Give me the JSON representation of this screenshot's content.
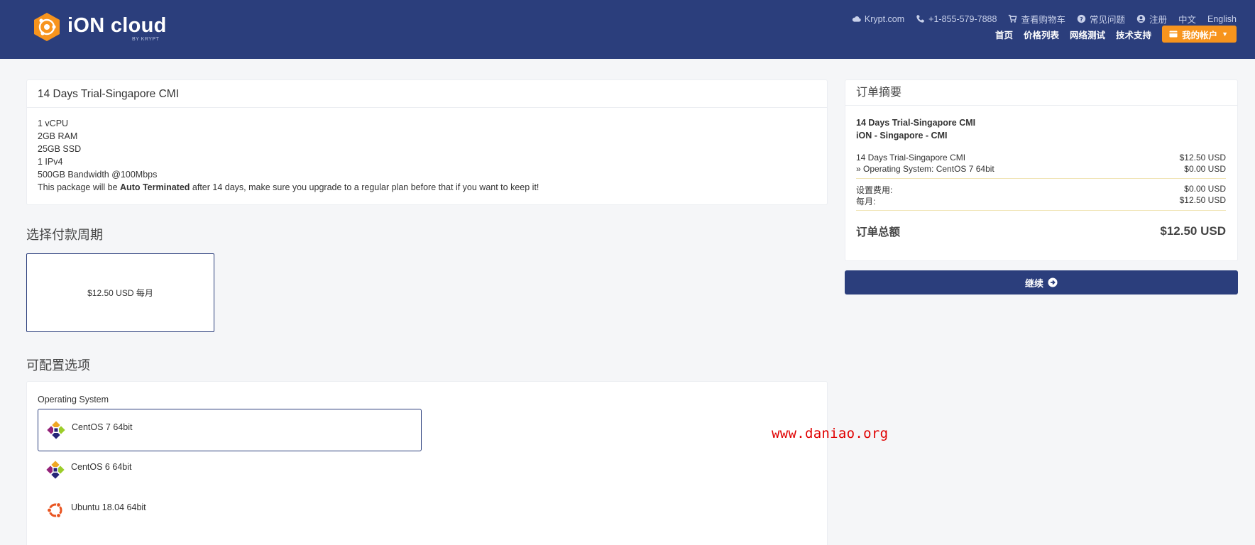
{
  "brand": {
    "name": "iON cloud",
    "sub": "BY KRYPT"
  },
  "topbar": {
    "krypt": "Krypt.com",
    "phone": "+1-855-579-7888",
    "cart": "查看购物车",
    "faq": "常见问题",
    "register": "注册",
    "lang_cn": "中文",
    "lang_en": "English"
  },
  "nav": {
    "home": "首页",
    "pricing": "价格列表",
    "nettest": "网络测试",
    "support": "技术支持",
    "account": "我的帐户"
  },
  "product": {
    "title": "14 Days Trial-Singapore CMI",
    "specs": [
      "1 vCPU",
      "2GB RAM",
      "25GB SSD",
      "1 IPv4",
      "500GB Bandwidth @100Mbps"
    ],
    "note_pre": "This package will be ",
    "note_bold": "Auto Terminated",
    "note_post": " after 14 days, make sure you upgrade to a regular plan before that if you want to keep it!"
  },
  "billing": {
    "heading": "选择付款周期",
    "option": "$12.50 USD 每月"
  },
  "config": {
    "heading": "可配置选项",
    "label": "Operating System",
    "options": [
      {
        "name": "CentOS 7 64bit",
        "icon": "centos-icon",
        "selected": true
      },
      {
        "name": "CentOS 6 64bit",
        "icon": "centos-icon",
        "selected": false
      },
      {
        "name": "Ubuntu 18.04 64bit",
        "icon": "ubuntu-icon",
        "selected": false
      }
    ]
  },
  "summary": {
    "title": "订单摘要",
    "product": "14 Days Trial-Singapore CMI",
    "group": "iON - Singapore - CMI",
    "lines": [
      {
        "label": "14 Days Trial-Singapore CMI",
        "value": "$12.50 USD"
      },
      {
        "label": "» Operating System: CentOS 7 64bit",
        "value": "$0.00 USD"
      }
    ],
    "setup_label": "设置费用:",
    "setup_value": "$0.00 USD",
    "monthly_label": "每月:",
    "monthly_value": "$12.50 USD",
    "total_label": "订单总额",
    "total_value": "$12.50 USD"
  },
  "continue_label": "继续",
  "watermark": "www.daniao.org",
  "colors": {
    "header": "#2b3e7c",
    "accent": "#f7941d",
    "watermark": "#e00000"
  }
}
